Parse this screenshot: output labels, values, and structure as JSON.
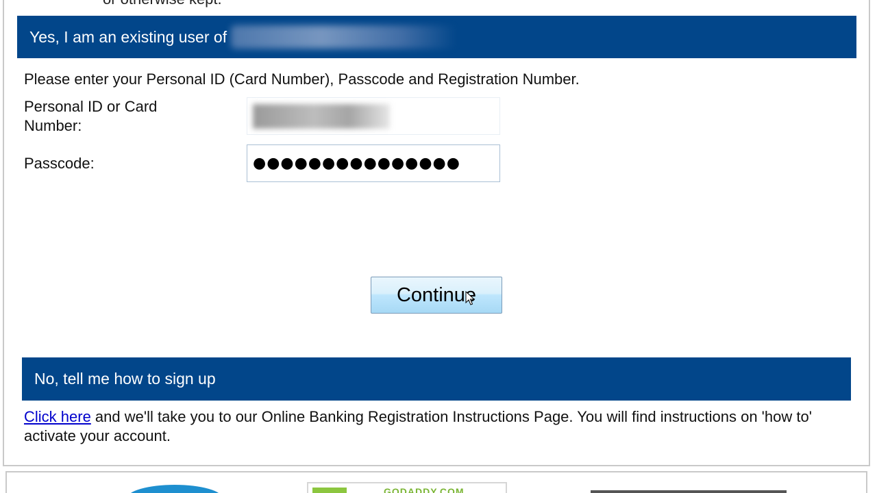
{
  "top_cut_text": "or otherwise kept.",
  "existing_user": {
    "banner_label": "Yes, I am an existing user of",
    "instructions": "Please enter your Personal ID (Card Number), Passcode and Registration Number.",
    "personal_id_label": "Personal ID or Card Number:",
    "passcode_label": "Passcode:",
    "passcode_value": "●●●●●●●●●●●●●●●",
    "continue_label": "Continue"
  },
  "signup": {
    "banner_label": "No, tell me how to sign up",
    "link_text": "Click here",
    "description": " and we'll take you to our Online Banking Registration Instructions Page. You will find instructions on 'how to' activate your account."
  },
  "footer": {
    "badge_text": "GODADDY.COM"
  },
  "colors": {
    "banner_bg": "#02468a",
    "banner_text": "#ffffff",
    "link": "#0000cc",
    "button_gradient_top": "#eaf6fd",
    "button_gradient_bottom": "#a7d9f5"
  }
}
